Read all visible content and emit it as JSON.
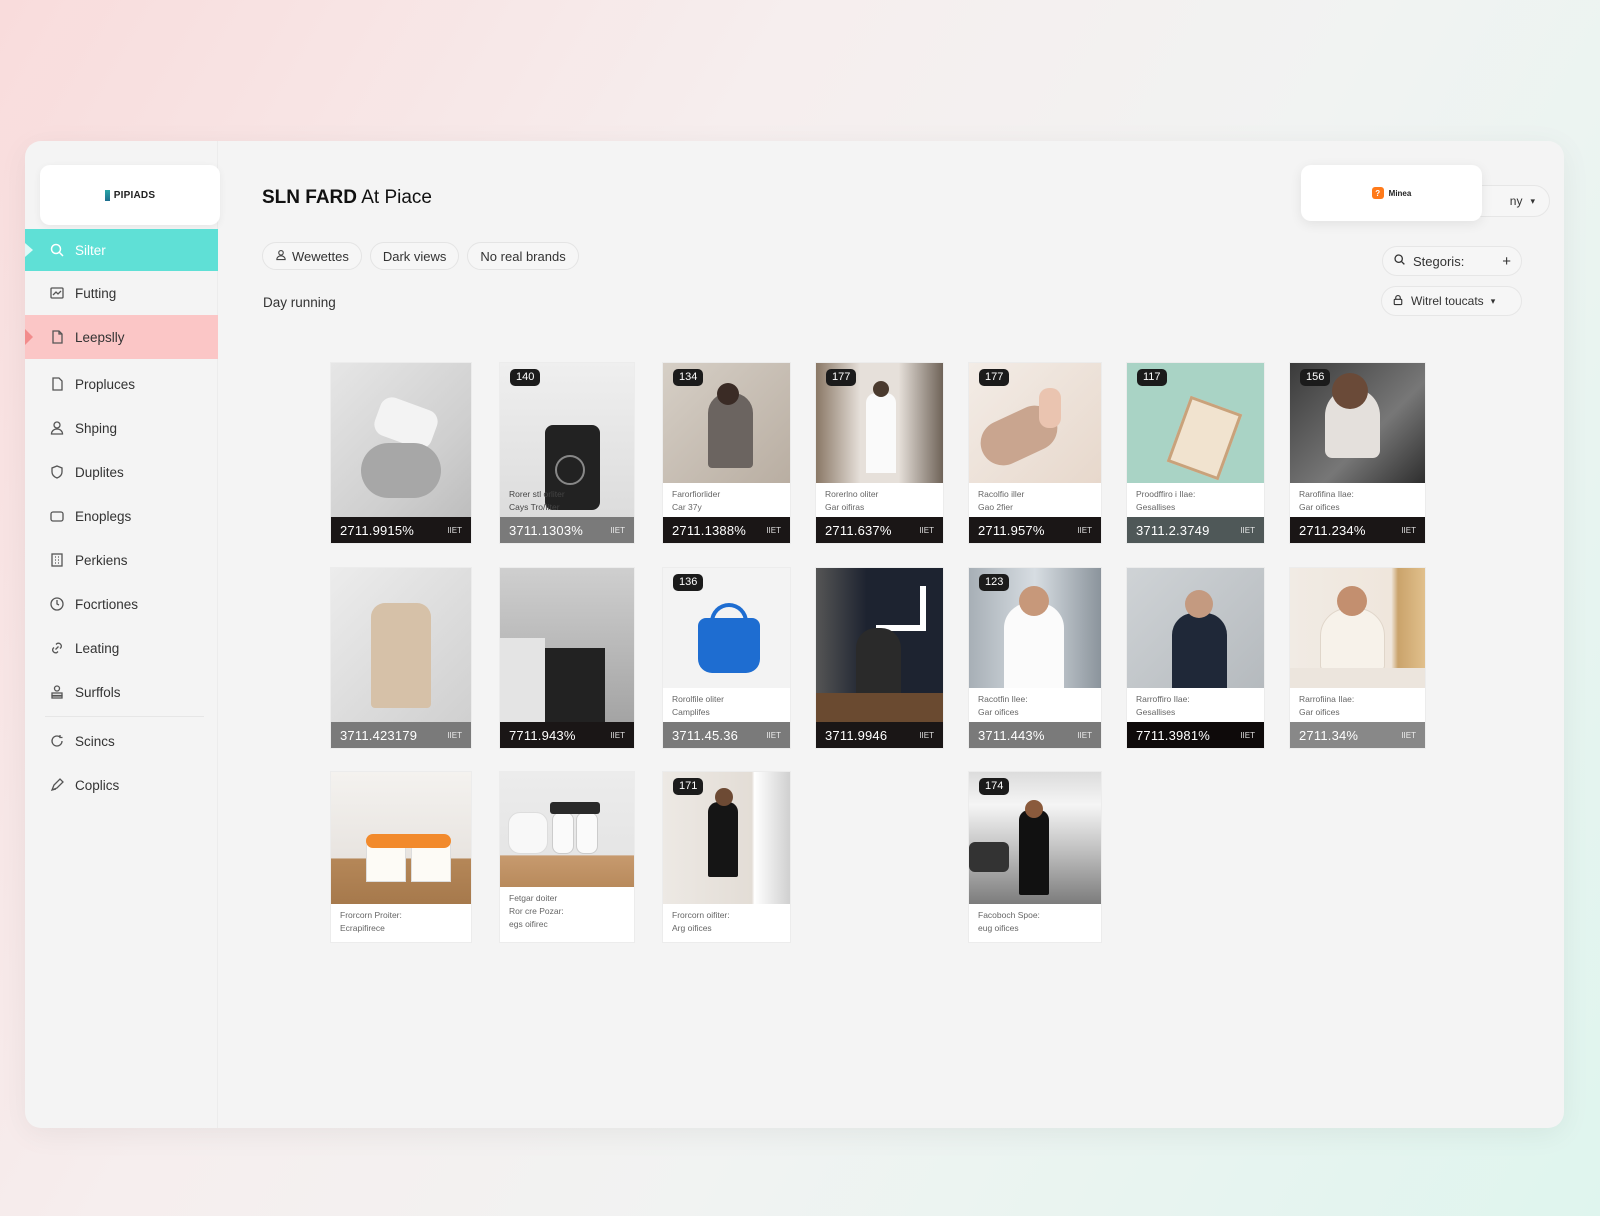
{
  "logo": {
    "text": "PIPIADS"
  },
  "sidebar": {
    "items": [
      {
        "label": "Silter",
        "icon": "search-icon"
      },
      {
        "label": "Futting",
        "icon": "chart-icon"
      },
      {
        "label": "Leepslly",
        "icon": "document-icon"
      },
      {
        "label": "Propluces",
        "icon": "file-icon"
      },
      {
        "label": "Shping",
        "icon": "user-icon"
      },
      {
        "label": "Duplites",
        "icon": "shield-icon"
      },
      {
        "label": "Enoplegs",
        "icon": "folder-icon"
      },
      {
        "label": "Perkiens",
        "icon": "building-icon"
      },
      {
        "label": "Focrtiones",
        "icon": "clock-icon"
      },
      {
        "label": "Leating",
        "icon": "link-icon"
      },
      {
        "label": "Surffols",
        "icon": "person-stack-icon"
      },
      {
        "label": "Scincs",
        "icon": "refresh-icon"
      },
      {
        "label": "Coplics",
        "icon": "pen-icon"
      }
    ]
  },
  "header": {
    "title_bold": "SLN FARD",
    "title_rest": " At Piace",
    "chips": [
      "Wewettes",
      "Dark views",
      "No real brands"
    ],
    "subhead": "Day running",
    "app_card": {
      "badge": "?",
      "label": "Minea"
    },
    "top_dropdown": "ny",
    "search_placeholder": "Stegoris:",
    "filter_dropdown": "Witrel toucats"
  },
  "cards": [
    {
      "badge": "",
      "meta1": "",
      "meta2": "",
      "value": "2711.9915%",
      "tag": "IIET",
      "dark": true
    },
    {
      "badge": "140",
      "meta1": "Rorer stl orliter",
      "meta2": "Cays Tro/Iiter",
      "value": "3711.1303%",
      "tag": "IIET",
      "dark": false
    },
    {
      "badge": "134",
      "meta1": "Farorfiorlider",
      "meta2": "Car 37y",
      "value": "2711.1388%",
      "tag": "IIET",
      "dark": true
    },
    {
      "badge": "177",
      "meta1": "Rorerlno oliter",
      "meta2": "Gar oifiras",
      "value": "2711.637%",
      "tag": "IIET",
      "dark": true
    },
    {
      "badge": "177",
      "meta1": "Racolfio iller",
      "meta2": "Gao 2fier",
      "value": "2711.957%",
      "tag": "IIET",
      "dark": true
    },
    {
      "badge": "117",
      "meta1": "Proodffiro i Ilae:",
      "meta2": "Gesallises",
      "value": "3711.2.3749",
      "tag": "IIET",
      "dark": true
    },
    {
      "badge": "156",
      "meta1": "Rarofifina Ilae:",
      "meta2": "Gar oifices",
      "value": "2711.234%",
      "tag": "IIET",
      "dark": true
    },
    {
      "badge": "",
      "meta1": "",
      "meta2": "",
      "value": "3711.423179",
      "tag": "IIET",
      "dark": false
    },
    {
      "badge": "",
      "meta1": "",
      "meta2": "",
      "value": "7711.943%",
      "tag": "IIET",
      "dark": true
    },
    {
      "badge": "136",
      "meta1": "Rorolfile oliter",
      "meta2": "Camplifes",
      "value": "3711.45.36",
      "tag": "IIET",
      "dark": false
    },
    {
      "badge": "",
      "meta1": "",
      "meta2": "",
      "value": "3711.9946",
      "tag": "IIET",
      "dark": true
    },
    {
      "badge": "123",
      "meta1": "Racotfin Ilee:",
      "meta2": "Gar oifices",
      "value": "3711.443%",
      "tag": "IIET",
      "dark": false
    },
    {
      "badge": "",
      "meta1": "Rarroffiro Ilae:",
      "meta2": "Gesallises",
      "value": "7711.3981%",
      "tag": "IIET",
      "dark": true
    },
    {
      "badge": "",
      "meta1": "Rarrofiina Ilae:",
      "meta2": "Gar oifices",
      "value": "2711.34%",
      "tag": "IIET",
      "dark": false
    },
    {
      "badge": "",
      "meta1": "Frorcorn Proiter:",
      "meta2": "Ecrapifirece",
      "value": "",
      "tag": "",
      "dark": false
    },
    {
      "badge": "",
      "meta1": "Fetgar doiter",
      "meta2": "Ror cre Pozar:",
      "meta3": "egs oifirec",
      "value": "",
      "tag": "",
      "dark": false
    },
    {
      "badge": "171",
      "meta1": "Frorcorn oifiter:",
      "meta2": "Arg oifices",
      "value": "",
      "tag": "",
      "dark": false
    },
    {
      "badge": "174",
      "meta1": "Facoboch Spoe:",
      "meta2": "eug oifices",
      "value": "",
      "tag": "",
      "dark": false
    }
  ]
}
